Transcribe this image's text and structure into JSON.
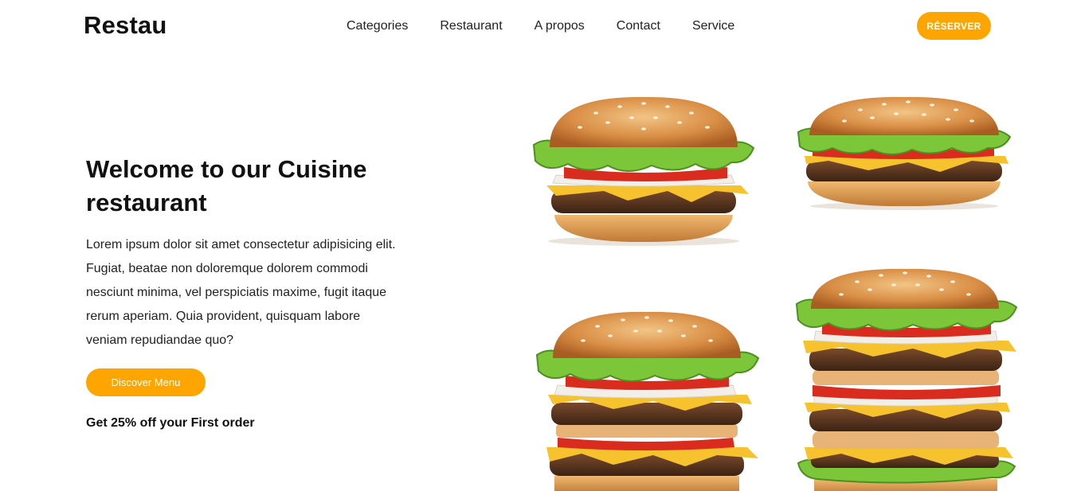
{
  "brand": {
    "logo": "Restau"
  },
  "nav": {
    "items": [
      "Categories",
      "Restaurant",
      "A propos",
      "Contact",
      "Service"
    ],
    "cta_label": "RÉSERVER"
  },
  "hero": {
    "title": "Welcome to our Cuisine restaurant",
    "text": "Lorem ipsum dolor sit amet consectetur adipisicing elit. Fugiat, beatae non doloremque dolorem commodi nesciunt minima, vel perspiciatis maxime, fugit itaque rerum aperiam. Quia provident, quisquam labore veniam repudiandae quo?",
    "button_label": "Discover Menu",
    "offer": "Get 25% off your First order"
  },
  "gallery": {
    "images": [
      "burger-icon",
      "burger-icon",
      "double-burger-icon",
      "triple-burger-icon"
    ]
  },
  "colors": {
    "accent": "#ffa500",
    "text": "#111111",
    "background": "#ffffff"
  }
}
